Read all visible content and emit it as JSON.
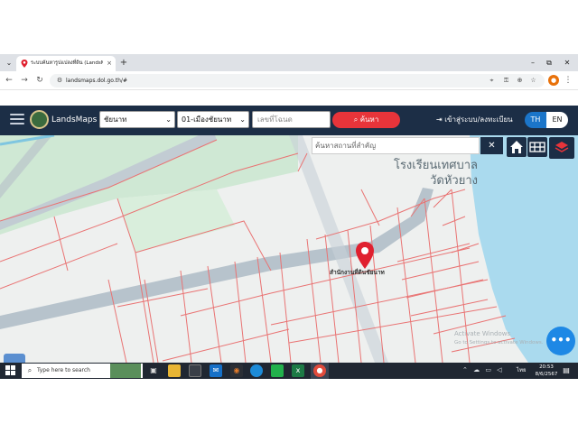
{
  "browser": {
    "tab_title": "ระบบค้นหารูปแปลงที่ดิน (LandsMa...",
    "tab_close": "×",
    "new_tab": "+",
    "tab_dropdown": "⌄",
    "window_controls": {
      "minimize": "–",
      "restore": "⧉",
      "close": "✕"
    },
    "nav": {
      "back": "←",
      "forward": "→",
      "reload": "↻"
    },
    "url": "landsmaps.dol.go.th/#",
    "omnibox_icons": [
      "location-icon",
      "key-icon",
      "zoom-icon",
      "star-icon"
    ],
    "omnibox_glyphs": {
      "location": "⌖",
      "key": "⚿",
      "zoom": "⊕",
      "star": "☆"
    },
    "profile_initial": "●",
    "menu": "⋮"
  },
  "app": {
    "brand": "LandsMaps",
    "province": "ชัยนาท",
    "district": "01-เมืองชัยนาท",
    "parcel_placeholder": "เลขที่โฉนด",
    "search_label": "ค้นหา",
    "login_label": "เข้าสู่ระบบ/ลงทะเบียน",
    "lang_th": "TH",
    "lang_en": "EN",
    "dropdown_chevron": "⌄"
  },
  "map": {
    "place_search_placeholder": "ค้นหาสถานที่สำคัญ",
    "place_search_close": "✕",
    "label_school_line1": "โรงเรียนเทศบาล",
    "label_school_line2": "วัดหัวยาง",
    "label_office": "สำนักงานที่ดินชัยนาท",
    "watermark_title": "Activate Windows",
    "watermark_sub": "Go to Settings to activate Windows.",
    "fab_label": "•••",
    "colors": {
      "water": "#aadaee",
      "green": "#cfe8d4",
      "road": "#b7c3cc",
      "parcel": "#e97373",
      "pin": "#e0202f"
    }
  },
  "taskbar": {
    "search_text": "Type here to search",
    "search_icon": "⌕",
    "tray_symbols": "⌃ ☁ ▭ ◁",
    "language": "ไทย",
    "time": "20:53",
    "date": "8/6/2567",
    "notification": "▤"
  }
}
